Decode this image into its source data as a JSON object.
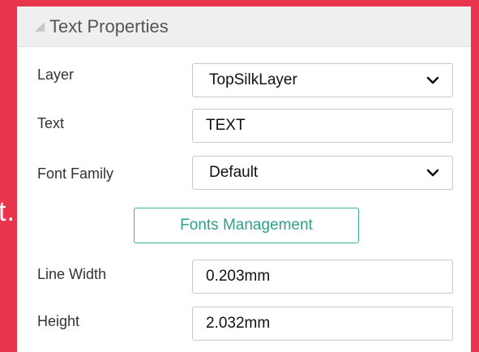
{
  "background_fragment": "t.",
  "panel": {
    "title": "Text Properties",
    "collapse_icon": "triangle-collapse-icon"
  },
  "fields": {
    "layer": {
      "label": "Layer",
      "value": "TopSilkLayer"
    },
    "text": {
      "label": "Text",
      "value": "TEXT"
    },
    "font_family": {
      "label": "Font Family",
      "value": "Default"
    },
    "fonts_management_label": "Fonts Management",
    "line_width": {
      "label": "Line Width",
      "value": "0.203mm"
    },
    "height": {
      "label": "Height",
      "value": "2.032mm"
    }
  },
  "colors": {
    "background": "#e8344c",
    "accent": "#3cb29b"
  }
}
